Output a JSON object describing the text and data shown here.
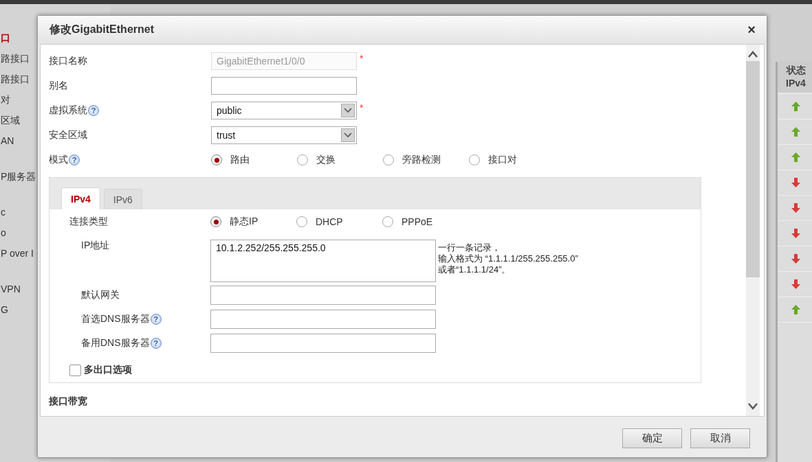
{
  "sidebar": {
    "items": [
      {
        "label": "口",
        "selected": true
      },
      {
        "label": "路接口",
        "selected": false
      },
      {
        "label": "路接口",
        "selected": false
      },
      {
        "label": "对",
        "selected": false
      },
      {
        "label": "区域",
        "selected": false
      },
      {
        "label": "AN",
        "selected": false
      },
      {
        "label": "P服务器",
        "selected": false
      },
      {
        "label": "c",
        "selected": false
      },
      {
        "label": "o",
        "selected": false
      },
      {
        "label": "P over I",
        "selected": false
      },
      {
        "label": "VPN",
        "selected": false
      },
      {
        "label": "G",
        "selected": false
      }
    ]
  },
  "status_table": {
    "header": [
      "状态",
      "IPv4"
    ],
    "rows": [
      {
        "kind": "up"
      },
      {
        "kind": "up"
      },
      {
        "kind": "up"
      },
      {
        "kind": "down"
      },
      {
        "kind": "down"
      },
      {
        "kind": "down"
      },
      {
        "kind": "down"
      },
      {
        "kind": "down"
      },
      {
        "kind": "up"
      }
    ]
  },
  "dialog": {
    "title": "修改GigabitEthernet",
    "close": "×",
    "fields": [
      {
        "kind": "text",
        "label": "接口名称",
        "value": "GigabitEthernet1/0/0",
        "disabled": true,
        "required_mark": "*"
      },
      {
        "kind": "text",
        "label": "别名",
        "disabled": false
      },
      {
        "kind": "select",
        "label": "虚拟系统",
        "value": "public",
        "required_mark": "*",
        "help": "?"
      },
      {
        "kind": "select",
        "label": "安全区域",
        "value": "trust"
      },
      {
        "kind": "radio",
        "label": "模式",
        "help": "?",
        "options": [
          {
            "label": "路由",
            "selected": true
          },
          {
            "label": "交换",
            "selected": false
          },
          {
            "label": "旁路检测",
            "selected": false
          },
          {
            "label": "接口对",
            "selected": false
          }
        ]
      }
    ],
    "tabs": [
      {
        "label": "IPv4",
        "selected": true
      },
      {
        "label": "IPv6",
        "selected": false
      }
    ],
    "connection": {
      "label": "连接类型",
      "options": [
        {
          "label": "静态IP",
          "selected": true
        },
        {
          "label": "DHCP",
          "selected": false
        },
        {
          "label": "PPPoE",
          "selected": false
        }
      ]
    },
    "ip_address": {
      "label": "IP地址",
      "value": "10.1.2.252/255.255.255.0",
      "hint": [
        "一行一条记录，",
        "输入格式为 “1.1.1.1/255.255.255.0”",
        "或者“1.1.1.1/24”。"
      ]
    },
    "ip_fields": [
      {
        "label": "默认网关"
      },
      {
        "label": "首选DNS服务器",
        "help": "?"
      },
      {
        "label": "备用DNS服务器",
        "help": "?"
      }
    ],
    "multi_exit": {
      "label": "多出口选项",
      "checked": false
    },
    "section": "接口带宽",
    "buttons": [
      "确定",
      "取消"
    ]
  }
}
